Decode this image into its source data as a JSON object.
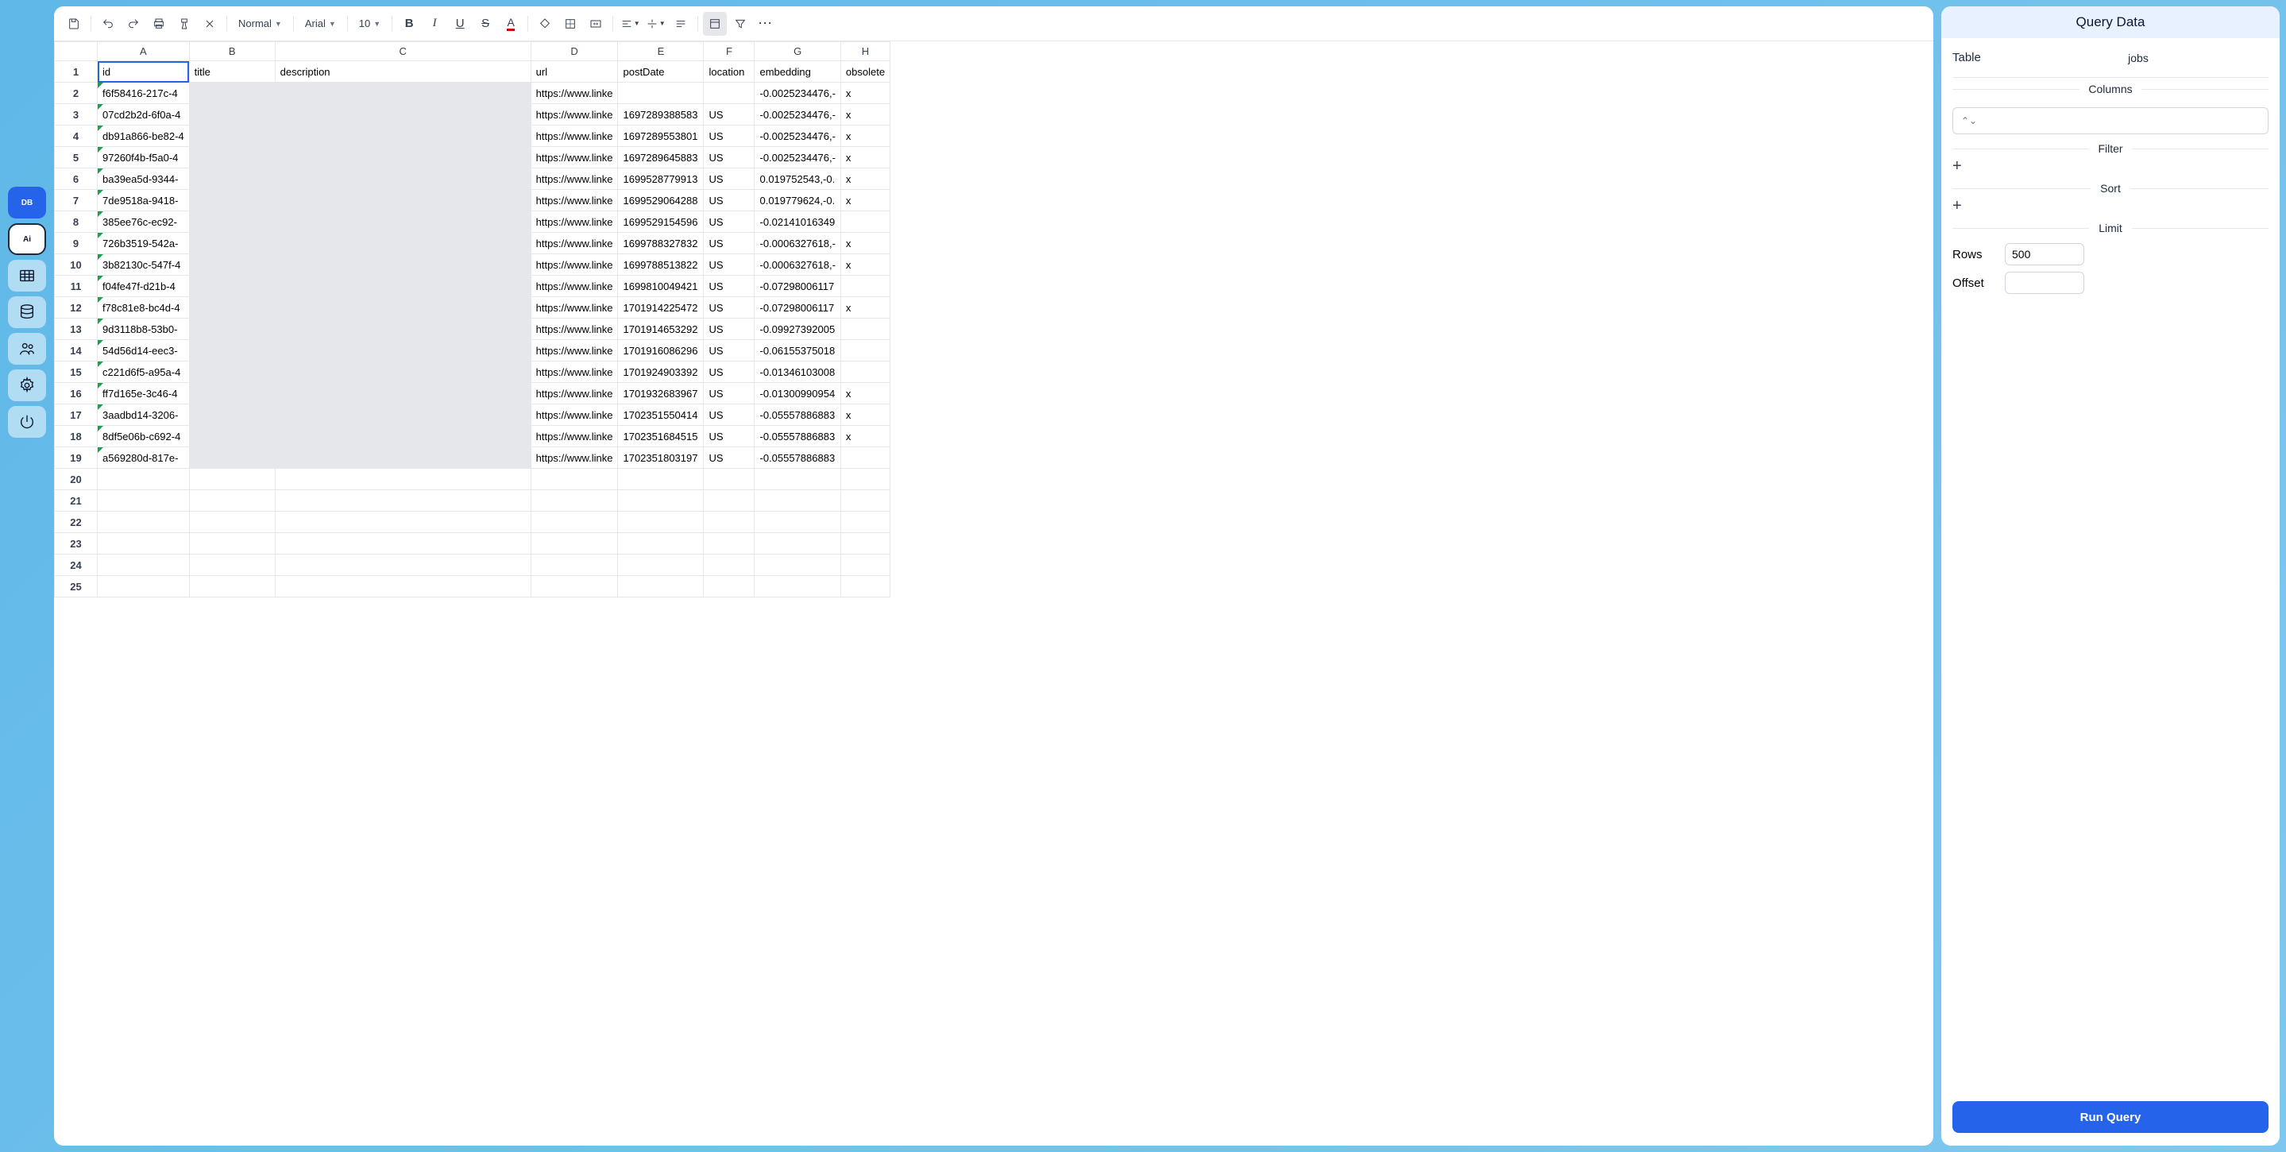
{
  "sidebar": {
    "db": "DB",
    "ai": "Ai"
  },
  "toolbar": {
    "style_select": "Normal",
    "font_select": "Arial",
    "size_select": "10"
  },
  "columns": [
    "A",
    "B",
    "C",
    "D",
    "E",
    "F",
    "G",
    "H"
  ],
  "headers": {
    "A": "id",
    "B": "title",
    "C": "description",
    "D": "url",
    "E": "postDate",
    "F": "location",
    "G": "embedding",
    "H": "obsolete"
  },
  "rows": [
    {
      "id": "f6f58416-217c-4",
      "url": "https://www.linke",
      "postDate": "",
      "location": "",
      "embedding": "-0.0025234476,-",
      "obsolete": "x"
    },
    {
      "id": "07cd2b2d-6f0a-4",
      "url": "https://www.linke",
      "postDate": "1697289388583",
      "location": "US",
      "embedding": "-0.0025234476,-",
      "obsolete": "x"
    },
    {
      "id": "db91a866-be82-4",
      "url": "https://www.linke",
      "postDate": "1697289553801",
      "location": "US",
      "embedding": "-0.0025234476,-",
      "obsolete": "x"
    },
    {
      "id": "97260f4b-f5a0-4",
      "url": "https://www.linke",
      "postDate": "1697289645883",
      "location": "US",
      "embedding": "-0.0025234476,-",
      "obsolete": "x"
    },
    {
      "id": "ba39ea5d-9344-",
      "url": "https://www.linke",
      "postDate": "1699528779913",
      "location": "US",
      "embedding": "0.019752543,-0.",
      "obsolete": "x"
    },
    {
      "id": "7de9518a-9418-",
      "url": "https://www.linke",
      "postDate": "1699529064288",
      "location": "US",
      "embedding": "0.019779624,-0.",
      "obsolete": "x"
    },
    {
      "id": "385ee76c-ec92-",
      "url": "https://www.linke",
      "postDate": "1699529154596",
      "location": "US",
      "embedding": "-0.02141016349",
      "obsolete": ""
    },
    {
      "id": "726b3519-542a-",
      "url": "https://www.linke",
      "postDate": "1699788327832",
      "location": "US",
      "embedding": "-0.0006327618,-",
      "obsolete": "x"
    },
    {
      "id": "3b82130c-547f-4",
      "url": "https://www.linke",
      "postDate": "1699788513822",
      "location": "US",
      "embedding": "-0.0006327618,-",
      "obsolete": "x"
    },
    {
      "id": "f04fe47f-d21b-4",
      "url": "https://www.linke",
      "postDate": "1699810049421",
      "location": "US",
      "embedding": "-0.07298006117",
      "obsolete": ""
    },
    {
      "id": "f78c81e8-bc4d-4",
      "url": "https://www.linke",
      "postDate": "1701914225472",
      "location": "US",
      "embedding": "-0.07298006117",
      "obsolete": "x"
    },
    {
      "id": "9d3118b8-53b0-",
      "url": "https://www.linke",
      "postDate": "1701914653292",
      "location": "US",
      "embedding": "-0.09927392005",
      "obsolete": ""
    },
    {
      "id": "54d56d14-eec3-",
      "url": "https://www.linke",
      "postDate": "1701916086296",
      "location": "US",
      "embedding": "-0.06155375018",
      "obsolete": ""
    },
    {
      "id": "c221d6f5-a95a-4",
      "url": "https://www.linke",
      "postDate": "1701924903392",
      "location": "US",
      "embedding": "-0.01346103008",
      "obsolete": ""
    },
    {
      "id": "ff7d165e-3c46-4",
      "url": "https://www.linke",
      "postDate": "1701932683967",
      "location": "US",
      "embedding": "-0.01300990954",
      "obsolete": "x"
    },
    {
      "id": "3aadbd14-3206-",
      "url": "https://www.linke",
      "postDate": "1702351550414",
      "location": "US",
      "embedding": "-0.05557886883",
      "obsolete": "x"
    },
    {
      "id": "8df5e06b-c692-4",
      "url": "https://www.linke",
      "postDate": "1702351684515",
      "location": "US",
      "embedding": "-0.05557886883",
      "obsolete": "x"
    },
    {
      "id": "a569280d-817e-",
      "url": "https://www.linke",
      "postDate": "1702351803197",
      "location": "US",
      "embedding": "-0.05557886883",
      "obsolete": ""
    }
  ],
  "empty_rows": [
    20,
    21,
    22,
    23,
    24,
    25
  ],
  "query": {
    "title": "Query Data",
    "table_label": "Table",
    "table_value": "jobs",
    "columns_label": "Columns",
    "filter_label": "Filter",
    "sort_label": "Sort",
    "limit_label": "Limit",
    "rows_label": "Rows",
    "rows_value": "500",
    "offset_label": "Offset",
    "offset_value": "",
    "run_label": "Run Query"
  }
}
